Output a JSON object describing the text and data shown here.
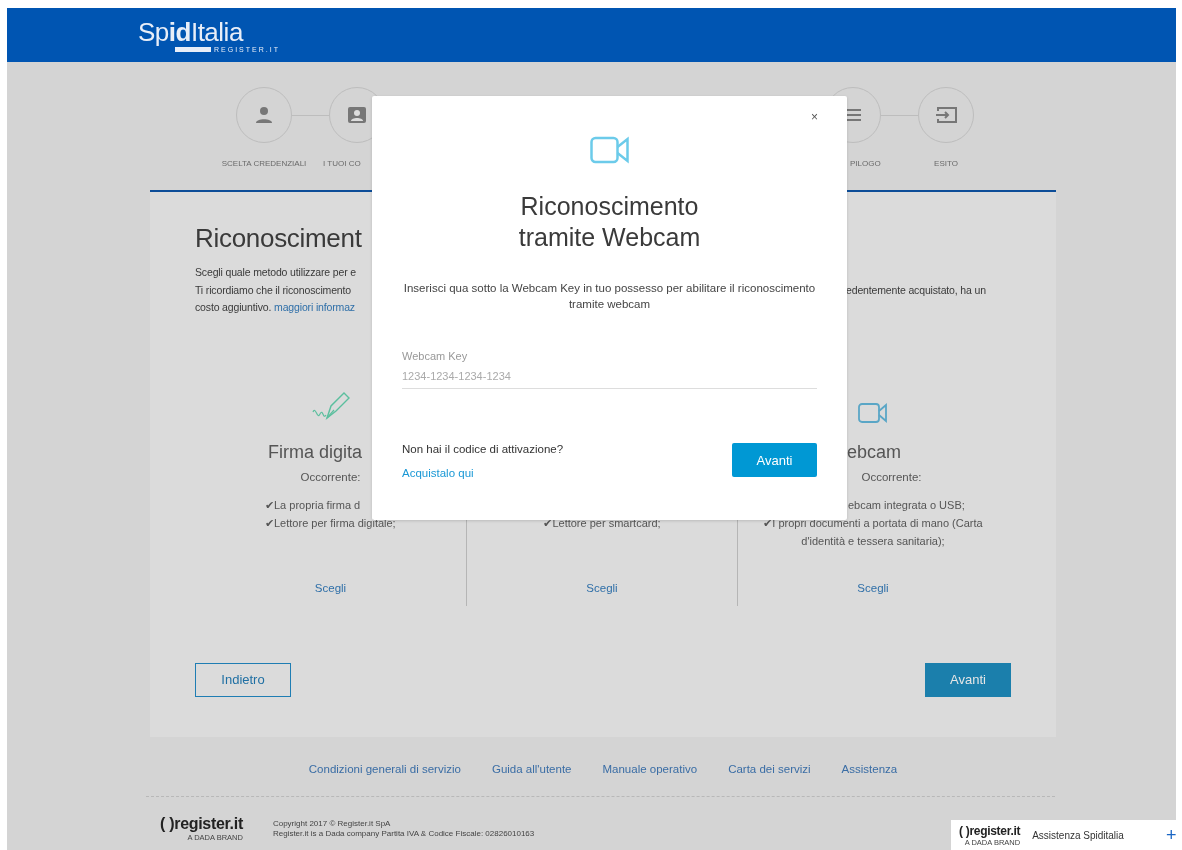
{
  "header": {
    "logo": "Sp**id**Italia",
    "logo_sub": "REGISTER.IT"
  },
  "steps": [
    {
      "kind": "person",
      "label": "SCELTA CREDENZIALI"
    },
    {
      "kind": "card",
      "label": "I TUOI CO"
    },
    {
      "kind": "list",
      "label": "PILOGO"
    },
    {
      "kind": "exit",
      "label": "ESITO"
    }
  ],
  "card": {
    "title": "Riconosciment",
    "intro": [
      {
        "text": "Scegli quale metodo utilizzare per e"
      },
      {
        "text": "Ti ricordiamo che il riconoscimento",
        "continued": "edentemente acquistato, ha un"
      },
      {
        "text": "costo aggiuntivo.",
        "link": "maggiori informaz"
      }
    ],
    "methods": [
      {
        "kind": "signature",
        "title": "Firma digita",
        "requirement": "Occorrente:",
        "items": [
          "✔La propria firma d",
          "✔Lettore per firma digitale;"
        ],
        "link": "Scegli"
      },
      {
        "kind": "smartcard",
        "items": [
          "✔Lettore per smartcard;"
        ],
        "link": "Scegli"
      },
      {
        "kind": "webcam",
        "title": "ebcam",
        "requirement": "Occorrente:",
        "items": [
          "ebcam integrata o USB;",
          "✔I propri documenti a portata di mano (Carta d'identità e tessera sanitaria);"
        ],
        "link": "Scegli"
      }
    ],
    "back_button": "Indietro",
    "next_button": "Avanti"
  },
  "footer_links": [
    "Condizioni generali di servizio",
    "Guida all'utente",
    "Manuale operativo",
    "Carta dei servizi",
    "Assistenza"
  ],
  "footer": {
    "logo": "( )register.it",
    "logo_sub": "A DADA BRAND",
    "copyright": [
      "Copyright 2017 © Register.it SpA",
      "Register.it is a Dada company Partita IVA & Codice Fiscale: 02826010163"
    ]
  },
  "help_widget": {
    "logo": "( )register.it",
    "logo_sub": "A DADA BRAND",
    "label": "Assistenza Spiditalia",
    "icon": "+"
  },
  "modal": {
    "close": "×",
    "title": "Riconoscimento tramite Webcam",
    "description": "Inserisci qua sotto la Webcam Key in tuo possesso per abilitare il riconoscimento tramite webcam",
    "field": {
      "label": "Webcam Key",
      "placeholder": "1234-1234-1234-1234"
    },
    "question": "Non hai il codice di attivazione?",
    "link": "Acquistalo qui",
    "button": "Avanti"
  }
}
